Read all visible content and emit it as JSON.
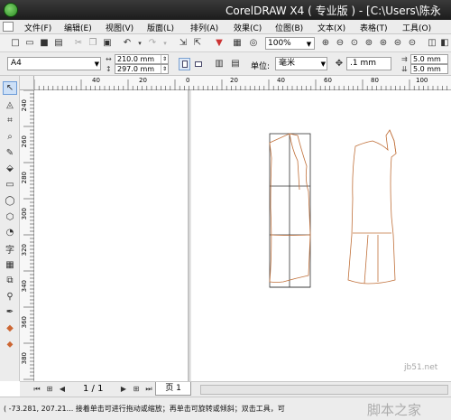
{
  "window": {
    "title": "CorelDRAW X4 ( 专业版 ) - [C:\\Users\\陈永"
  },
  "menu": {
    "items": [
      "文件(F)",
      "编辑(E)",
      "视图(V)",
      "版面(L)",
      "排列(A)",
      "效果(C)",
      "位图(B)",
      "文本(X)",
      "表格(T)",
      "工具(O)"
    ]
  },
  "toolbar": {
    "zoom_value": "100%"
  },
  "property_bar": {
    "paper_size": "A4",
    "width": "210.0 mm",
    "height": "297.0 mm",
    "unit_label": "单位:",
    "unit_value": "毫米",
    "nudge_value": ".1 mm",
    "duplicate_x": "5.0 mm",
    "duplicate_y": "5.0 mm"
  },
  "ruler": {
    "h_ticks": [
      "40",
      "20",
      "0",
      "20",
      "40",
      "60",
      "80",
      "100"
    ],
    "v_ticks": [
      "240",
      "260",
      "280",
      "300",
      "320",
      "340",
      "360",
      "380"
    ]
  },
  "page_nav": {
    "count": "1 / 1",
    "tab_label": "页 1"
  },
  "status": {
    "text": "( -73.281, 207.21... 接着单击可进行拖动或缩放；再单击可旋转或倾斜；双击工具，可"
  },
  "watermark": {
    "url": "jb51.net",
    "name": "脚本之家"
  },
  "colors": {
    "title_bar": "#2a2a2a",
    "garment_outline": "#c0703a",
    "pattern_grid": "#333333"
  }
}
